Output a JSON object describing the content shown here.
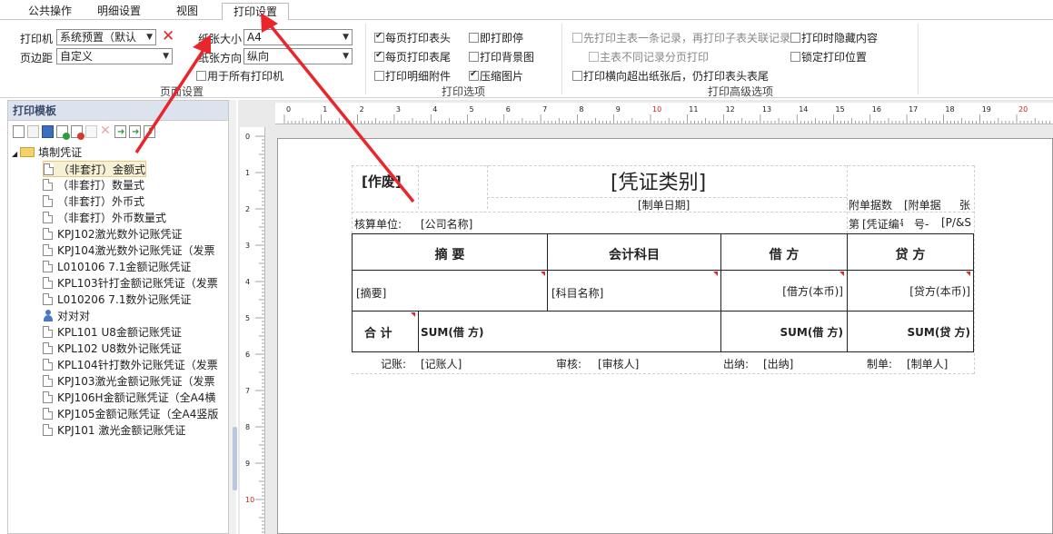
{
  "tabs": [
    "公共操作",
    "明细设置",
    "视图",
    "打印设置"
  ],
  "ribbon": {
    "printer_label": "打印机",
    "printer_value": "系统预置（默认",
    "margin_label": "页边距",
    "margin_value": "自定义",
    "paper_size_label": "纸张大小",
    "paper_size_value": "A4",
    "orientation_label": "纸张方向",
    "orientation_value": "纵向",
    "use_all_printers": "用于所有打印机",
    "page_setup_group": "页面设置",
    "print_options": {
      "header_each_page": "每页打印表头",
      "footer_each_page": "每页打印表尾",
      "print_attachments": "打印明细附件",
      "print_immediately": "即打即停",
      "print_background": "打印背景图",
      "compress_image": "压缩图片",
      "group_label": "打印选项"
    },
    "advanced": {
      "print_main_first": "先打印主表一条记录，再打印子表关联记录",
      "main_diff_page": "主表不同记录分页打印",
      "print_header_overflow": "打印横向超出纸张后，仍打印表头表尾",
      "hide_content": "打印时隐藏内容",
      "lock_position": "锁定打印位置",
      "group_label": "打印高级选项"
    }
  },
  "left_panel": {
    "title": "打印模板",
    "root": "填制凭证",
    "items": [
      "（非套打）金额式",
      "（非套打）数量式",
      "（非套打）外币式",
      "（非套打）外币数量式",
      "KPJ102激光数外记账凭证",
      "KPJ104激光数外记账凭证（发票",
      "L010106 7.1金额记账凭证",
      "KPL103针打金额记账凭证（发票",
      "L010206 7.1数外记账凭证",
      "对对对",
      "KPL101 U8金额记账凭证",
      "KPL102 U8数外记账凭证",
      "KPL104针打数外记账凭证（发票",
      "KPJ103激光金额记账凭证（发票",
      "KPJ106H金额记账凭证（全A4横",
      "KPJ105金额记账凭证（全A4竖版",
      "KPJ101 激光金额记账凭证"
    ]
  },
  "ruler": {
    "h": [
      "0",
      "1",
      "2",
      "3",
      "4",
      "5",
      "6",
      "7",
      "8",
      "9",
      "10",
      "11",
      "12",
      "13",
      "14",
      "15",
      "16",
      "17",
      "18",
      "19",
      "20"
    ],
    "v": [
      "0",
      "1",
      "2",
      "3",
      "4",
      "5",
      "6",
      "7",
      "8",
      "9",
      "10"
    ]
  },
  "voucher": {
    "void_label": "[作废]",
    "title": "[凭证类别]",
    "date": "[制单日期]",
    "attach_label": "附单据数",
    "attach_value": "[附单据",
    "attach_unit": "张",
    "unit_label": "核算单位:",
    "unit_value": "[公司名称]",
    "voucher_no_label": "第",
    "voucher_no_value": "[凭证编号",
    "no_suffix": "号-",
    "page_value": "[P/&S",
    "headers": [
      "摘  要",
      "会计科目",
      "借  方",
      "贷  方"
    ],
    "row": [
      "[摘要]",
      "[科目名称]",
      "[借方(本币)]",
      "[贷方(本币)]"
    ],
    "total_label": "合  计",
    "total_formula": "SUM(借  方)",
    "total_debit": "SUM(借  方)",
    "total_credit": "SUM(贷  方)",
    "footer": {
      "bookkeeper_label": "记账:",
      "bookkeeper_value": "[记账人]",
      "auditor_label": "审核:",
      "auditor_value": "[审核人]",
      "cashier_label": "出纳:",
      "cashier_value": "[出纳]",
      "maker_label": "制单:",
      "maker_value": "[制单人]"
    }
  },
  "colors": {
    "arrow": "#e8262c",
    "accent": "#dde3ee"
  }
}
